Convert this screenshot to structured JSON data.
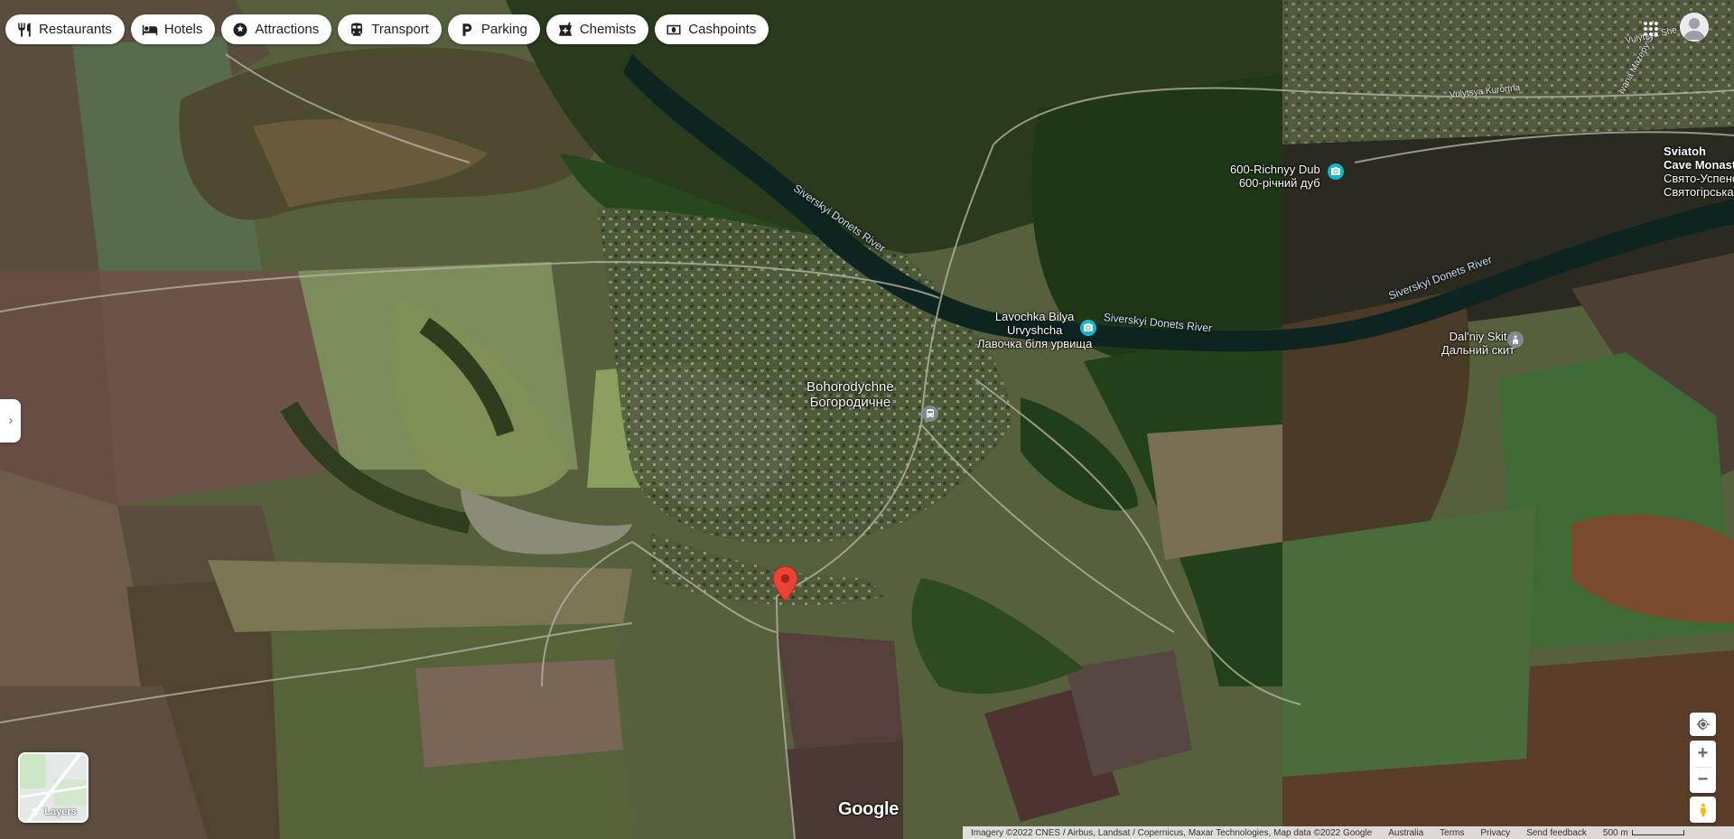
{
  "chips": [
    {
      "label": "Restaurants",
      "icon": "fork-knife-icon"
    },
    {
      "label": "Hotels",
      "icon": "bed-icon"
    },
    {
      "label": "Attractions",
      "icon": "attraction-icon"
    },
    {
      "label": "Transport",
      "icon": "train-icon"
    },
    {
      "label": "Parking",
      "icon": "parking-icon"
    },
    {
      "label": "Chemists",
      "icon": "pharmacy-icon"
    },
    {
      "label": "Cashpoints",
      "icon": "cash-icon"
    }
  ],
  "places": {
    "village": {
      "name": "Bohorodychne",
      "local": "Богородичне"
    },
    "poi_dub": {
      "name": "600-Richnyy Dub",
      "local": "600-річний дуб"
    },
    "poi_lavochka": {
      "name_line1": "Lavochka Bilya",
      "name_line2": "Urvyshcha",
      "local": "Лавочка біля урвища"
    },
    "poi_skit": {
      "name": "Dal'niy Skit",
      "local": "Дальний скит"
    },
    "monastery": {
      "name_line1": "Sviatoh",
      "name_line2": "Cave Monast",
      "local_line1": "Свято-Успенс",
      "local_line2": "Святогірська Л"
    }
  },
  "rivers": {
    "label_1": "Siverskyi Donets River",
    "label_2": "Siverskyi Donets River",
    "label_3": "Siverskyi Donets River"
  },
  "streets": {
    "kurortna": "Vulytsya Kurortna",
    "shevch": "Vulytsya She",
    "mazepy": "Ivana Mazepy St"
  },
  "layers": {
    "label": "Layers"
  },
  "branding": {
    "logo": "Google"
  },
  "bottom_bar": {
    "imagery": "Imagery ©2022 CNES / Airbus, Landsat / Copernicus, Maxar Technologies, Map data ©2022 Google",
    "region": "Australia",
    "terms": "Terms",
    "privacy": "Privacy",
    "feedback": "Send feedback",
    "scale": "500 m"
  },
  "colors": {
    "poi_teal": "#12b5cb",
    "poi_grey": "#7e8b92",
    "pin_red": "#ea4335",
    "river": "#0d2420"
  }
}
